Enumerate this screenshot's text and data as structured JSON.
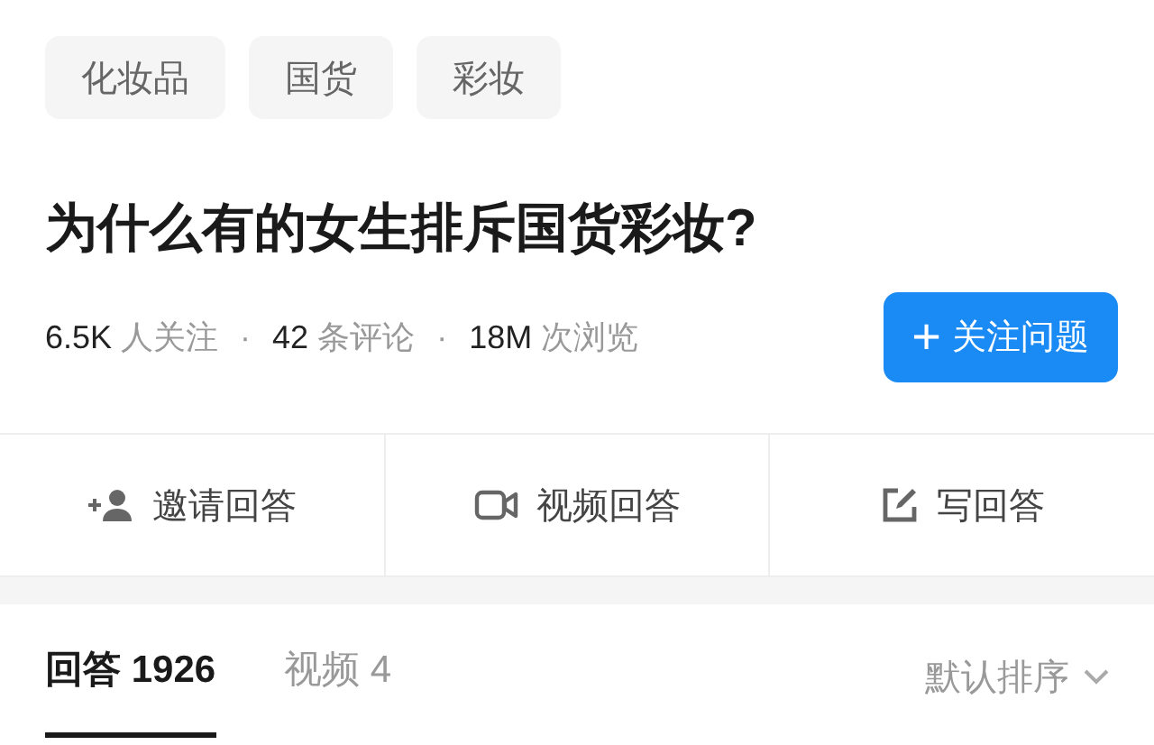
{
  "tags": [
    "化妆品",
    "国货",
    "彩妆"
  ],
  "title": "为什么有的女生排斥国货彩妆?",
  "stats": [
    {
      "count": "6.5K",
      "caption": "人关注"
    },
    {
      "count": "42",
      "caption": "条评论"
    },
    {
      "count": "18M",
      "caption": "次浏览"
    }
  ],
  "stat_separators": [
    "·",
    "·"
  ],
  "follow_button": {
    "icon": "+",
    "label": "关注问题"
  },
  "actions": [
    {
      "kind": "invite",
      "label": "邀请回答"
    },
    {
      "kind": "video",
      "label": "视频回答"
    },
    {
      "kind": "write",
      "label": "写回答"
    }
  ],
  "tabs": [
    {
      "label": "回答 1926",
      "selected": true
    },
    {
      "label": "视频 4",
      "selected": false
    }
  ],
  "sort": {
    "label": "默认排序"
  }
}
